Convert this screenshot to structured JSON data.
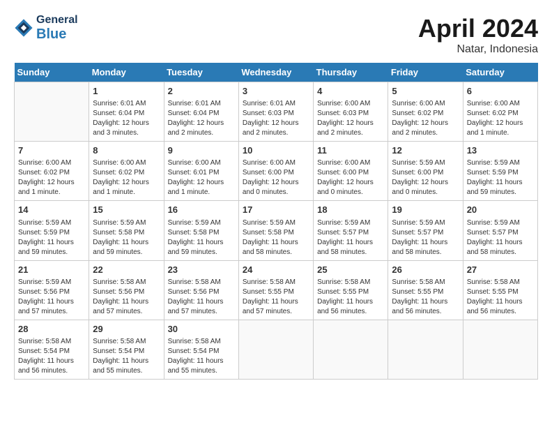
{
  "header": {
    "logo_general": "General",
    "logo_blue": "Blue",
    "title": "April 2024",
    "subtitle": "Natar, Indonesia"
  },
  "weekdays": [
    "Sunday",
    "Monday",
    "Tuesday",
    "Wednesday",
    "Thursday",
    "Friday",
    "Saturday"
  ],
  "weeks": [
    [
      {
        "day": "",
        "info": ""
      },
      {
        "day": "1",
        "info": "Sunrise: 6:01 AM\nSunset: 6:04 PM\nDaylight: 12 hours\nand 3 minutes."
      },
      {
        "day": "2",
        "info": "Sunrise: 6:01 AM\nSunset: 6:04 PM\nDaylight: 12 hours\nand 2 minutes."
      },
      {
        "day": "3",
        "info": "Sunrise: 6:01 AM\nSunset: 6:03 PM\nDaylight: 12 hours\nand 2 minutes."
      },
      {
        "day": "4",
        "info": "Sunrise: 6:00 AM\nSunset: 6:03 PM\nDaylight: 12 hours\nand 2 minutes."
      },
      {
        "day": "5",
        "info": "Sunrise: 6:00 AM\nSunset: 6:02 PM\nDaylight: 12 hours\nand 2 minutes."
      },
      {
        "day": "6",
        "info": "Sunrise: 6:00 AM\nSunset: 6:02 PM\nDaylight: 12 hours\nand 1 minute."
      }
    ],
    [
      {
        "day": "7",
        "info": "Sunrise: 6:00 AM\nSunset: 6:02 PM\nDaylight: 12 hours\nand 1 minute."
      },
      {
        "day": "8",
        "info": "Sunrise: 6:00 AM\nSunset: 6:02 PM\nDaylight: 12 hours\nand 1 minute."
      },
      {
        "day": "9",
        "info": "Sunrise: 6:00 AM\nSunset: 6:01 PM\nDaylight: 12 hours\nand 1 minute."
      },
      {
        "day": "10",
        "info": "Sunrise: 6:00 AM\nSunset: 6:00 PM\nDaylight: 12 hours\nand 0 minutes."
      },
      {
        "day": "11",
        "info": "Sunrise: 6:00 AM\nSunset: 6:00 PM\nDaylight: 12 hours\nand 0 minutes."
      },
      {
        "day": "12",
        "info": "Sunrise: 5:59 AM\nSunset: 6:00 PM\nDaylight: 12 hours\nand 0 minutes."
      },
      {
        "day": "13",
        "info": "Sunrise: 5:59 AM\nSunset: 5:59 PM\nDaylight: 11 hours\nand 59 minutes."
      }
    ],
    [
      {
        "day": "14",
        "info": "Sunrise: 5:59 AM\nSunset: 5:59 PM\nDaylight: 11 hours\nand 59 minutes."
      },
      {
        "day": "15",
        "info": "Sunrise: 5:59 AM\nSunset: 5:58 PM\nDaylight: 11 hours\nand 59 minutes."
      },
      {
        "day": "16",
        "info": "Sunrise: 5:59 AM\nSunset: 5:58 PM\nDaylight: 11 hours\nand 59 minutes."
      },
      {
        "day": "17",
        "info": "Sunrise: 5:59 AM\nSunset: 5:58 PM\nDaylight: 11 hours\nand 58 minutes."
      },
      {
        "day": "18",
        "info": "Sunrise: 5:59 AM\nSunset: 5:57 PM\nDaylight: 11 hours\nand 58 minutes."
      },
      {
        "day": "19",
        "info": "Sunrise: 5:59 AM\nSunset: 5:57 PM\nDaylight: 11 hours\nand 58 minutes."
      },
      {
        "day": "20",
        "info": "Sunrise: 5:59 AM\nSunset: 5:57 PM\nDaylight: 11 hours\nand 58 minutes."
      }
    ],
    [
      {
        "day": "21",
        "info": "Sunrise: 5:59 AM\nSunset: 5:56 PM\nDaylight: 11 hours\nand 57 minutes."
      },
      {
        "day": "22",
        "info": "Sunrise: 5:58 AM\nSunset: 5:56 PM\nDaylight: 11 hours\nand 57 minutes."
      },
      {
        "day": "23",
        "info": "Sunrise: 5:58 AM\nSunset: 5:56 PM\nDaylight: 11 hours\nand 57 minutes."
      },
      {
        "day": "24",
        "info": "Sunrise: 5:58 AM\nSunset: 5:55 PM\nDaylight: 11 hours\nand 57 minutes."
      },
      {
        "day": "25",
        "info": "Sunrise: 5:58 AM\nSunset: 5:55 PM\nDaylight: 11 hours\nand 56 minutes."
      },
      {
        "day": "26",
        "info": "Sunrise: 5:58 AM\nSunset: 5:55 PM\nDaylight: 11 hours\nand 56 minutes."
      },
      {
        "day": "27",
        "info": "Sunrise: 5:58 AM\nSunset: 5:55 PM\nDaylight: 11 hours\nand 56 minutes."
      }
    ],
    [
      {
        "day": "28",
        "info": "Sunrise: 5:58 AM\nSunset: 5:54 PM\nDaylight: 11 hours\nand 56 minutes."
      },
      {
        "day": "29",
        "info": "Sunrise: 5:58 AM\nSunset: 5:54 PM\nDaylight: 11 hours\nand 55 minutes."
      },
      {
        "day": "30",
        "info": "Sunrise: 5:58 AM\nSunset: 5:54 PM\nDaylight: 11 hours\nand 55 minutes."
      },
      {
        "day": "",
        "info": ""
      },
      {
        "day": "",
        "info": ""
      },
      {
        "day": "",
        "info": ""
      },
      {
        "day": "",
        "info": ""
      }
    ]
  ]
}
